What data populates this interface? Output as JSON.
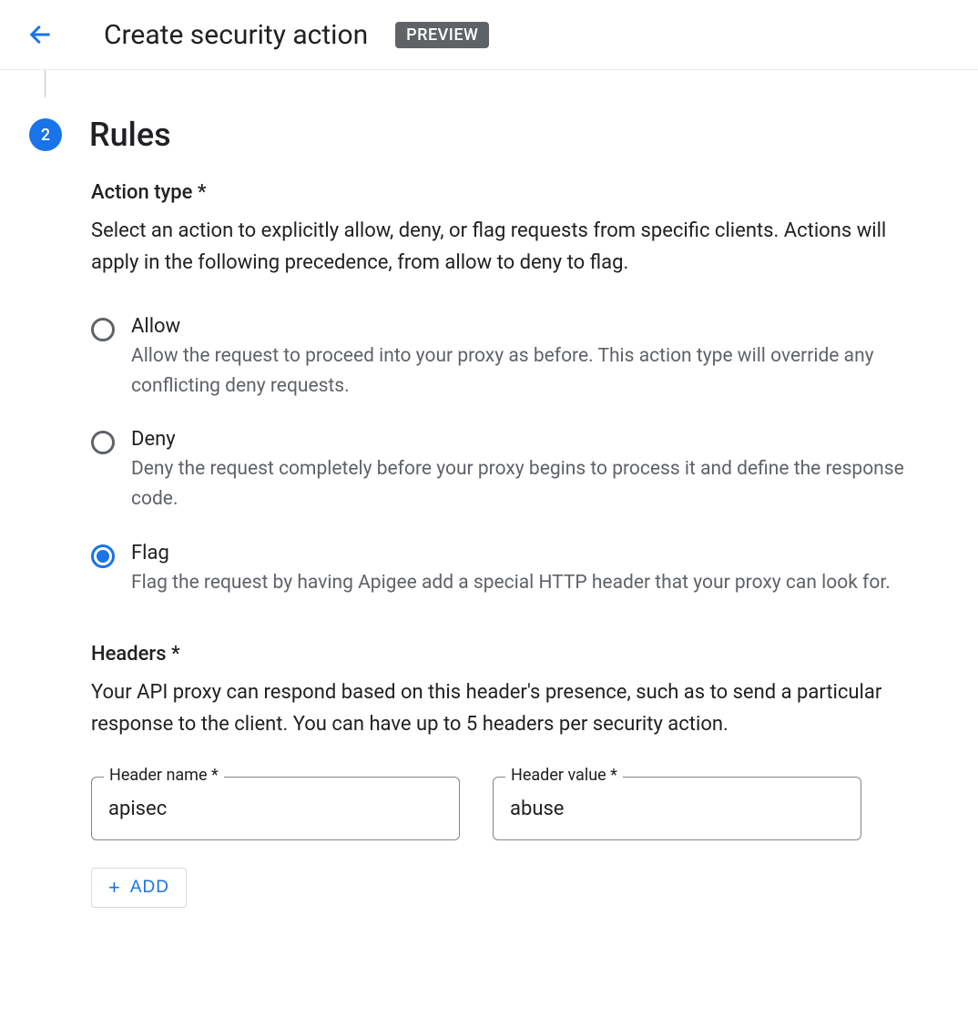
{
  "header": {
    "title": "Create security action",
    "badge": "PREVIEW"
  },
  "step": {
    "number": "2",
    "title": "Rules"
  },
  "actionType": {
    "label": "Action type *",
    "description": "Select an action to explicitly allow, deny, or flag requests from specific clients. Actions will apply in the following precedence, from allow to deny to flag.",
    "selected": "flag",
    "options": [
      {
        "id": "allow",
        "title": "Allow",
        "desc": "Allow the request to proceed into your proxy as before. This action type will override any conflicting deny requests."
      },
      {
        "id": "deny",
        "title": "Deny",
        "desc": "Deny the request completely before your proxy begins to process it and define the response code."
      },
      {
        "id": "flag",
        "title": "Flag",
        "desc": "Flag the request by having Apigee add a special HTTP header that your proxy can look for."
      }
    ]
  },
  "headers": {
    "label": "Headers *",
    "description": "Your API proxy can respond based on this header's presence, such as to send a particular response to the client. You can have up to 5 headers per security action.",
    "nameLabel": "Header name *",
    "valueLabel": "Header value *",
    "rows": [
      {
        "name": "apisec",
        "value": "abuse"
      }
    ],
    "addLabel": "ADD"
  }
}
